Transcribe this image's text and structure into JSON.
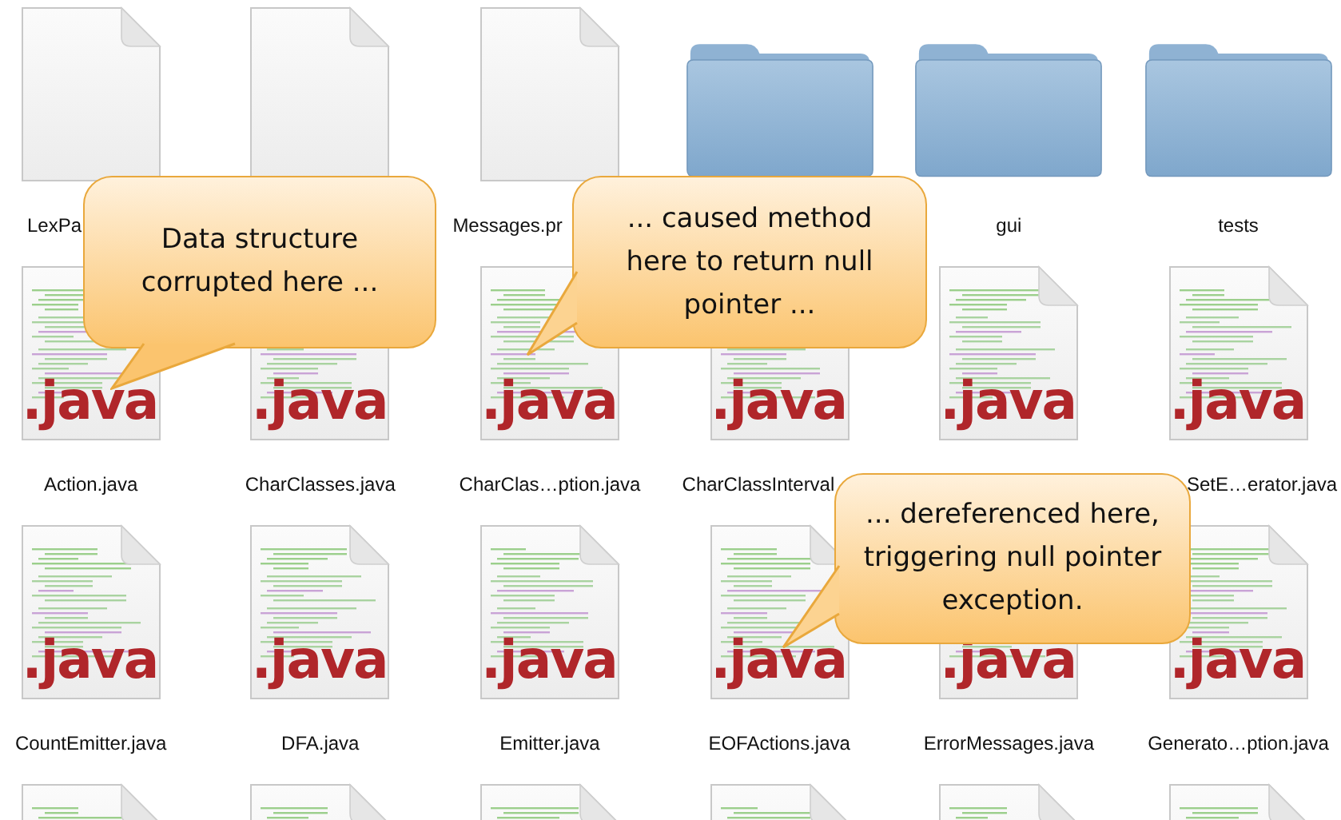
{
  "files": [
    {
      "kind": "blank",
      "label": "LexPa",
      "covered": true
    },
    {
      "kind": "blank"
    },
    {
      "kind": "blank",
      "label": "Messages.pr",
      "covered": true
    },
    {
      "kind": "folder"
    },
    {
      "kind": "folder",
      "label": "gui",
      "covered": false
    },
    {
      "kind": "folder",
      "label": "tests",
      "covered": false
    },
    {
      "kind": "java",
      "icon_text": ".java",
      "label": "Action.java",
      "covered": false
    },
    {
      "kind": "java",
      "icon_text": ".java",
      "label": "CharClasses.java",
      "covered": false
    },
    {
      "kind": "java",
      "icon_text": ".java",
      "label": "CharClas…ption.java",
      "covered": false
    },
    {
      "kind": "java",
      "icon_text": ".java",
      "label": "CharClassInterval",
      "covered": true
    },
    {
      "kind": "java",
      "icon_text": ".java"
    },
    {
      "kind": "java",
      "icon_text": ".java",
      "label": "SetE…erator.java",
      "covered": true
    },
    {
      "kind": "java",
      "icon_text": ".java",
      "label": "CountEmitter.java",
      "covered": false
    },
    {
      "kind": "java",
      "icon_text": ".java",
      "label": "DFA.java",
      "covered": false
    },
    {
      "kind": "java",
      "icon_text": ".java",
      "label": "Emitter.java",
      "covered": false
    },
    {
      "kind": "java",
      "icon_text": ".java",
      "label": "EOFActions.java",
      "covered": false
    },
    {
      "kind": "java",
      "icon_text": ".java",
      "label": "ErrorMessages.java",
      "covered": false
    },
    {
      "kind": "java",
      "icon_text": ".java",
      "label": "Generato…ption.java",
      "covered": false
    },
    {
      "kind": "java"
    },
    {
      "kind": "java"
    },
    {
      "kind": "java"
    },
    {
      "kind": "java"
    },
    {
      "kind": "java"
    },
    {
      "kind": "java"
    }
  ],
  "callouts": [
    {
      "text": "Data structure corrupted here ..."
    },
    {
      "text": "... caused method here to return null pointer ..."
    },
    {
      "text": "... dereferenced here, triggering null pointer exception."
    }
  ]
}
